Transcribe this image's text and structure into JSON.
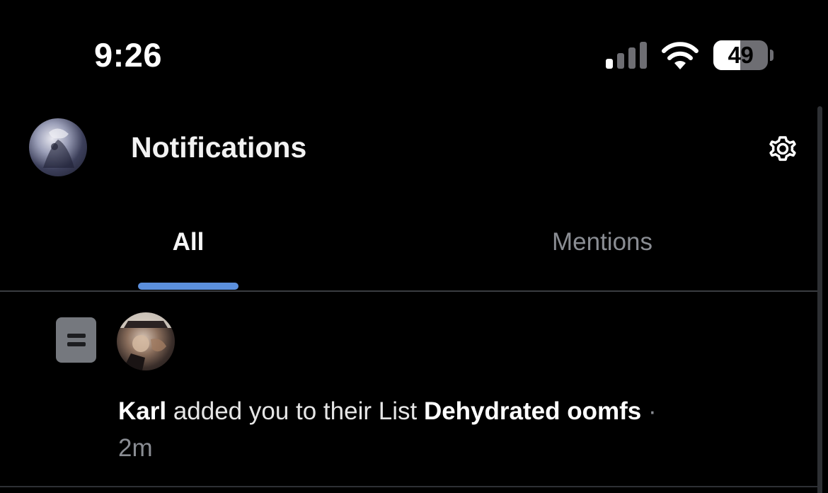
{
  "status_bar": {
    "time": "9:26",
    "battery_level": "49",
    "icons": [
      "signal-icon",
      "wifi-icon",
      "battery-icon"
    ]
  },
  "header": {
    "title": "Notifications",
    "avatar_icon": "profile-avatar",
    "settings_icon": "gear-icon"
  },
  "tabs": [
    {
      "label": "All",
      "selected": true
    },
    {
      "label": "Mentions",
      "selected": false
    }
  ],
  "notifications": [
    {
      "type_icon": "list-icon",
      "actor": "Karl",
      "action": " added you to their List ",
      "list_name": "Dehydrated oomfs",
      "separator": " ·",
      "time": "2m"
    }
  ],
  "colors": {
    "background": "#000000",
    "accent": "#5b8fdc",
    "muted_text": "#8a8d93",
    "list_icon_bg": "#75787e"
  }
}
